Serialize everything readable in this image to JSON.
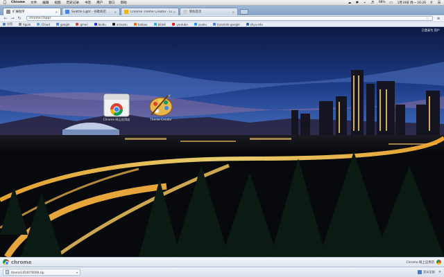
{
  "menubar": {
    "app_name": "Chrome",
    "items": [
      "文件",
      "编辑",
      "视图",
      "历史记录",
      "书签",
      "用户",
      "窗口",
      "帮助"
    ],
    "battery": "98%",
    "date_time": "1月19日 周一 16:26",
    "window_title": "扩展程序"
  },
  "tabs": [
    {
      "title": "扩展程序",
      "favicon_color": "#8a8a8a",
      "active": true
    },
    {
      "title": "Seattle Light - 谷歌商店",
      "favicon_color": "#4285f4",
      "active": false
    },
    {
      "title": "Chrome Theme Creator - Crea",
      "favicon_color": "#f4b400",
      "active": false
    },
    {
      "title": "新标签页",
      "favicon_color": "#cccccc",
      "active": false
    }
  ],
  "toolbar": {
    "url": "chrome://apps"
  },
  "bookmarks": [
    {
      "label": "应用",
      "color": "#4d7fd6"
    },
    {
      "label": "Apple",
      "color": "#888888"
    },
    {
      "label": "iCloud",
      "color": "#5aa0e6"
    },
    {
      "label": "google",
      "color": "#4285f4"
    },
    {
      "label": "gmail",
      "color": "#db4437"
    },
    {
      "label": "baidu",
      "color": "#2932e1"
    },
    {
      "label": "amazon",
      "color": "#222222"
    },
    {
      "label": "taobao",
      "color": "#ff6600"
    },
    {
      "label": "bilibili",
      "color": "#23ade5"
    },
    {
      "label": "youtube",
      "color": "#e62117"
    },
    {
      "label": "youku",
      "color": "#1e90ff"
    },
    {
      "label": "translate.google",
      "color": "#4285f4"
    },
    {
      "label": "zhyu.edu",
      "color": "#3366aa"
    }
  ],
  "content": {
    "user_text": "已登录为 用户"
  },
  "apps": [
    {
      "name": "chrome-web-store",
      "label": "Chrome 网上应用店"
    },
    {
      "name": "theme-creator",
      "label": "Theme Creator"
    }
  ],
  "ntpbar": {
    "brand": "chrome",
    "store_label": "Chrome 网上应用店"
  },
  "downloads": {
    "filename": "theme1454076009.zip",
    "show_all": "显示全部"
  }
}
